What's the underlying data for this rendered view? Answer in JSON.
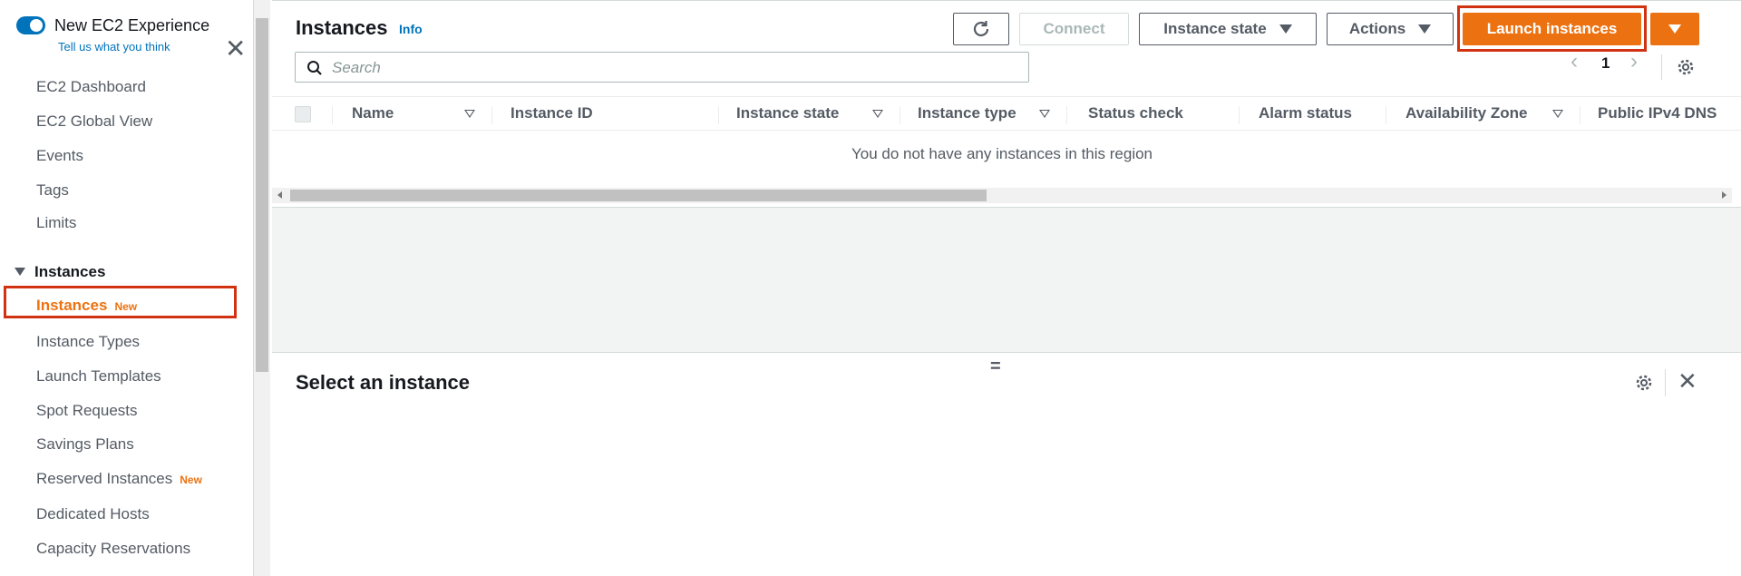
{
  "sidebar": {
    "toggle_label": "New EC2 Experience",
    "toggle_sub": "Tell us what you think",
    "items": [
      {
        "label": "EC2 Dashboard"
      },
      {
        "label": "EC2 Global View"
      },
      {
        "label": "Events"
      },
      {
        "label": "Tags"
      },
      {
        "label": "Limits"
      }
    ],
    "section": "Instances",
    "section_items": [
      {
        "label": "Instances",
        "badge": "New"
      },
      {
        "label": "Instance Types"
      },
      {
        "label": "Launch Templates"
      },
      {
        "label": "Spot Requests"
      },
      {
        "label": "Savings Plans"
      },
      {
        "label": "Reserved Instances",
        "badge": "New"
      },
      {
        "label": "Dedicated Hosts"
      },
      {
        "label": "Capacity Reservations"
      }
    ]
  },
  "header": {
    "title": "Instances",
    "info": "Info",
    "connect": "Connect",
    "instance_state": "Instance state",
    "actions": "Actions",
    "launch": "Launch instances"
  },
  "search": {
    "placeholder": "Search"
  },
  "pager": {
    "page": "1"
  },
  "table": {
    "columns": [
      "Name",
      "Instance ID",
      "Instance state",
      "Instance type",
      "Status check",
      "Alarm status",
      "Availability Zone",
      "Public IPv4 DNS"
    ],
    "empty": "You do not have any instances in this region"
  },
  "detail": {
    "title": "Select an instance",
    "grip": "="
  },
  "colors": {
    "accent": "#ec7211",
    "link": "#0073bb",
    "highlight": "#d13212"
  }
}
